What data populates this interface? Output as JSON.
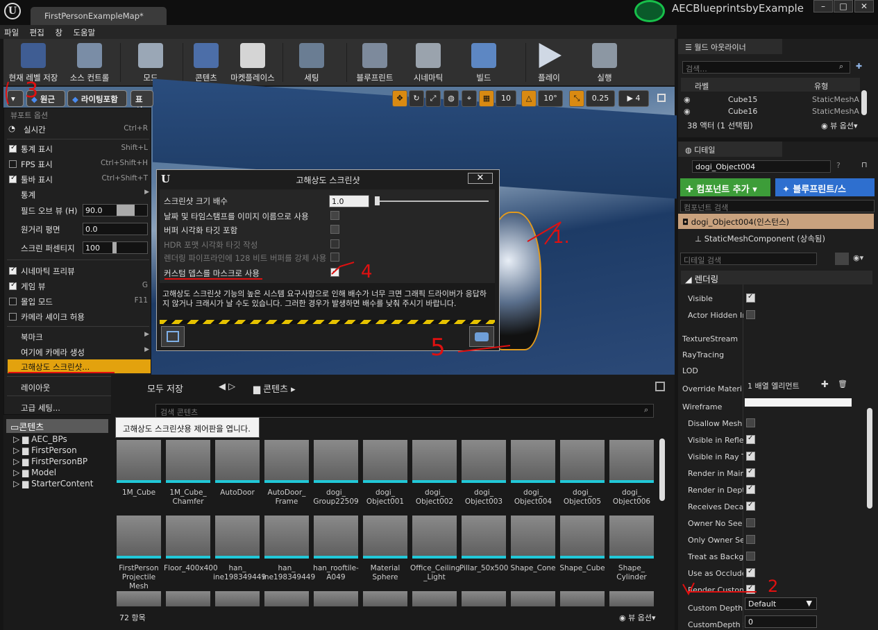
{
  "window": {
    "tab_title": "FirstPersonExampleMap*",
    "project_name": "AECBlueprintsbyExample",
    "min": "–",
    "max": "□",
    "close": "✕"
  },
  "menu": [
    "파일",
    "편집",
    "창",
    "도움말"
  ],
  "toolbar": [
    "현재 레벨 저장",
    "소스 컨트롤",
    "모드",
    "콘텐츠",
    "마켓플레이스",
    "세팅",
    "블루프린트",
    "시네마틱",
    "빌드",
    "플레이",
    "실행"
  ],
  "viewport_bar": {
    "perspective": "원근",
    "lighting": "라이팅포함",
    "show": "표시",
    "grid": "10",
    "rot": "10°",
    "scale": "0.25",
    "cam": "4"
  },
  "viewport_menu": {
    "header": "뷰포트 옵션",
    "realtime": "실시간",
    "realtime_sc": "Ctrl+R",
    "stats": "통계 표시",
    "stats_sc": "Shift+L",
    "fps": "FPS 표시",
    "fps_sc": "Ctrl+Shift+H",
    "toolbar": "툴바 표시",
    "toolbar_sc": "Ctrl+Shift+T",
    "statistics": "통계",
    "fov": "필드 오브 뷰 (H)",
    "fov_val": "90.0",
    "farplane": "원거리 평면",
    "far_val": "0.0",
    "percent": "스크린 퍼센티지",
    "pct_val": "100",
    "cine": "시네마틱 프리뷰",
    "gameview": "게임 뷰",
    "gameview_sc": "G",
    "immersive": "몰입 모드",
    "immersive_sc": "F11",
    "camshake": "카메라 셰이크 허용",
    "bookmark": "북마크",
    "createcam": "여기에 카메라 생성",
    "hires": "고해상도 스크린샷...",
    "layout": "레이아웃",
    "advanced": "고급 세팅..."
  },
  "dialog": {
    "title": "고해상도 스크린샷",
    "close": "✕",
    "size_label": "스크린샷 크기 배수",
    "size_val": "1.0",
    "opt1": "날짜 및 타임스탬프를 이미지 이름으로 사용",
    "opt2": "버퍼 시각화 타깃 포함",
    "opt3": "HDR 포맷 시각화 타깃 작성",
    "opt4": "렌더링 파이프라인에 128 비트 버퍼를 강제 사용",
    "opt5": "커스텀 뎁스를 마스크로 사용",
    "warning": "고해상도 스크린샷 기능의 높은 시스템 요구사항으로 인해 배수가 너무 크면 그래픽 드라이버가 응답하지 않거나 크래시가 날 수도 있습니다. 그러한 경우가 발생하면 배수를 낮춰 주시기 바랍니다."
  },
  "content": {
    "save_all": "모두 저장",
    "path": "콘텐츠",
    "search_placeholder": "검색 콘텐츠",
    "tooltip": "고해상도 스크린샷용 제어판을 엽니다.",
    "count": "72 항목",
    "view_options": "뷰 옵션",
    "tree": [
      "콘텐츠",
      "AEC_BPs",
      "FirstPerson",
      "FirstPersonBP",
      "Model",
      "StarterContent"
    ],
    "assets_row1": [
      "1M_Cube",
      "1M_Cube_ Chamfer",
      "AutoDoor",
      "AutoDoor_ Frame",
      "dogi_ Group22509",
      "dogi_ Object001",
      "dogi_ Object002",
      "dogi_ Object003",
      "dogi_ Object004",
      "dogi_ Object005",
      "dogi_ Object006"
    ],
    "assets_row2": [
      "FirstPerson Projectile Mesh",
      "Floor_400x400",
      "han_ ine198349449",
      "han_ ine198349449",
      "han_rooftile- A049",
      "Material Sphere",
      "Office_Ceiling _Light",
      "Pillar_50x500",
      "Shape_Cone",
      "Shape_Cube",
      "Shape_ Cylinder"
    ]
  },
  "outliner": {
    "title": "월드 아웃라이너",
    "search_placeholder": "검색...",
    "col_label": "라벨",
    "col_type": "유형",
    "rows": [
      {
        "name": "Cube15",
        "type": "StaticMeshA"
      },
      {
        "name": "Cube16",
        "type": "StaticMeshA"
      }
    ],
    "count": "38 액터 (1 선택됨)",
    "view_options": "뷰 옵션"
  },
  "details": {
    "title": "디테일",
    "object_name": "dogi_Object004",
    "add_component": "컴포넌트 추가",
    "blueprint": "블루프린트/스",
    "comp_search": "컴포넌트 검색",
    "instance": "dogi_Object004(인스턴스)",
    "component": "StaticMeshComponent (상속됨)",
    "detail_search": "디테일 검색",
    "section": "렌더링",
    "props": [
      "Visible",
      "Actor Hidden In",
      "TextureStream",
      "RayTracing",
      "LOD",
      "Override Materi",
      "Wireframe",
      "Disallow Mesh",
      "Visible in Reflec",
      "Visible in Ray T",
      "Render in Main",
      "Render in Depth",
      "Receives Decal",
      "Owner No See",
      "Only Owner See",
      "Treat as Backgr",
      "Use as Occlude",
      "Render Custom",
      "Custom Depth S",
      "CustomDepth S"
    ],
    "override_val": "1 배열 엘리먼트",
    "stencil_mode": "Default",
    "stencil_val": "0"
  },
  "annotations": [
    "1.",
    "2",
    "3",
    "4",
    "5"
  ]
}
